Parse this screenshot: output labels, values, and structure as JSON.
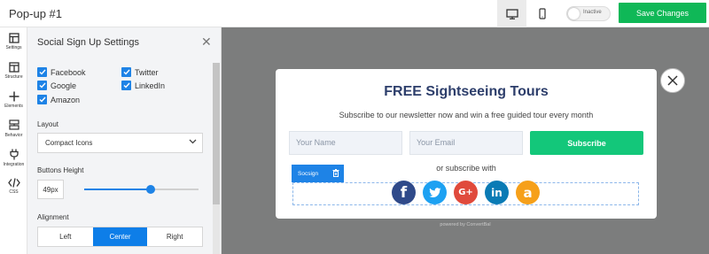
{
  "app": {
    "title": "Pop-up #1",
    "status_toggle_label": "Inactive",
    "save_label": "Save Changes"
  },
  "rail": {
    "items": [
      {
        "label": "Settings",
        "icon": "settings-icon"
      },
      {
        "label": "Structure",
        "icon": "structure-icon"
      },
      {
        "label": "Elements",
        "icon": "plus-icon"
      },
      {
        "label": "Behavior",
        "icon": "behavior-icon"
      },
      {
        "label": "Integration",
        "icon": "plug-icon"
      },
      {
        "label": "CSS",
        "icon": "code-icon"
      }
    ]
  },
  "panel": {
    "title": "Social Sign Up Settings",
    "networks": [
      {
        "label": "Facebook",
        "checked": true
      },
      {
        "label": "Twitter",
        "checked": true
      },
      {
        "label": "Google",
        "checked": true
      },
      {
        "label": "LinkedIn",
        "checked": true
      },
      {
        "label": "Amazon",
        "checked": true
      }
    ],
    "layout_label": "Layout",
    "layout_value": "Compact Icons",
    "height_label": "Buttons Height",
    "height_value": "49px",
    "height_slider_fraction": 0.58,
    "alignment_label": "Alignment",
    "alignment_options": [
      "Left",
      "Center",
      "Right"
    ],
    "alignment_selected": "Center"
  },
  "popup": {
    "title": "FREE Sightseeing Tours",
    "subtitle": "Subscribe to our newsletter now and win a free guided tour every month",
    "name_placeholder": "Your Name",
    "email_placeholder": "Your Email",
    "subscribe_label": "Subscribe",
    "or_text": "or subscribe with",
    "element_tag": "Socsign",
    "social_buttons": [
      {
        "glyph": "f",
        "color": "#2f4a8a",
        "icon": "facebook-icon"
      },
      {
        "glyph": "t",
        "color": "#1da1f2",
        "icon": "twitter-icon"
      },
      {
        "glyph": "G+",
        "color": "#e04a3c",
        "icon": "google-plus-icon"
      },
      {
        "glyph": "in",
        "color": "#0a7bb5",
        "icon": "linkedin-icon"
      },
      {
        "glyph": "a",
        "color": "#f6a01a",
        "icon": "amazon-icon"
      }
    ],
    "powered_by": "powered by ConvertBal"
  },
  "colors": {
    "accent_blue": "#1e83e6",
    "save_green": "#0fb857",
    "subscribe_green": "#13c77a",
    "title_navy": "#2d3e6b",
    "canvas_gray": "#7c7d7d"
  }
}
